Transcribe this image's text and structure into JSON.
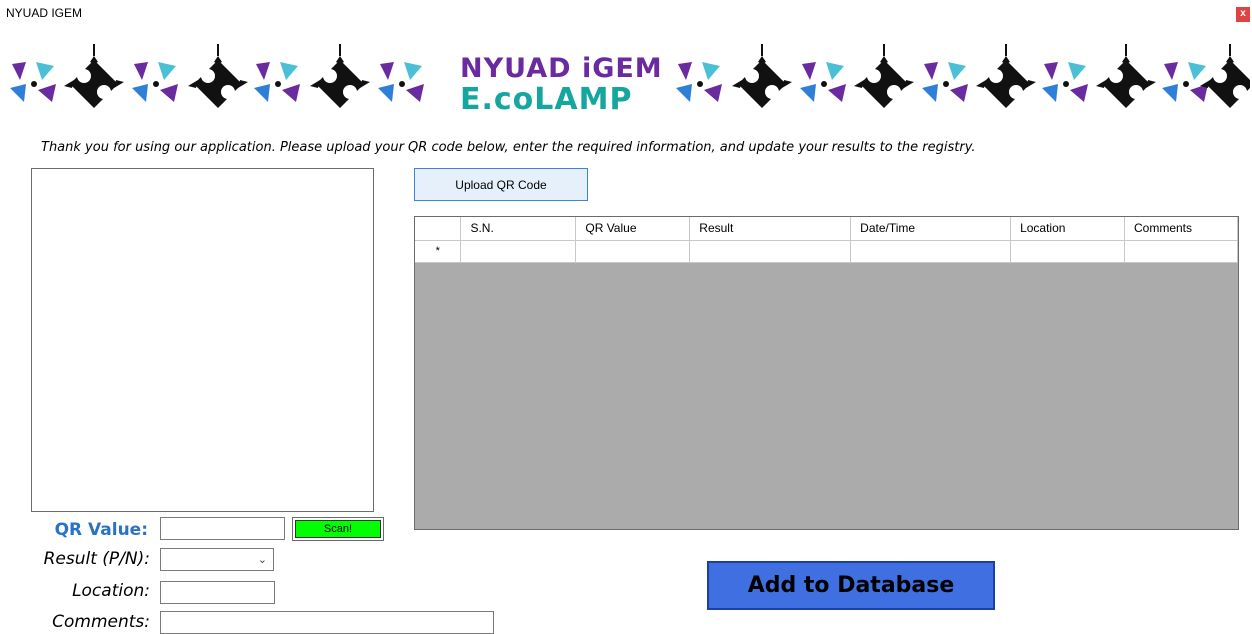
{
  "window": {
    "title": "NYUAD IGEM",
    "close_label": "x"
  },
  "banner": {
    "line1": "NYUAD iGEM",
    "line2": "E.coLAMP"
  },
  "instructions": "Thank you for using our application. Please upload your QR code below, enter the required information, and update your results to the registry.",
  "upload_button": "Upload QR Code",
  "grid": {
    "columns": [
      "S.N.",
      "QR Value",
      "Result",
      "Date/Time",
      "Location",
      "Comments"
    ],
    "new_row_marker": "*"
  },
  "form": {
    "qr_value_label": "QR Value:",
    "qr_value": "",
    "scan_label": "Scan!",
    "result_label": "Result (P/N):",
    "result_value": "",
    "location_label": "Location:",
    "location_value": "",
    "comments_label": "Comments:",
    "comments_value": ""
  },
  "add_button": "Add to Database",
  "colors": {
    "accent_blue": "#2a73c4",
    "add_button": "#3f6fe0",
    "scan_button": "#00ff00",
    "close_button": "#e04343",
    "grid_background": "#ababab"
  }
}
